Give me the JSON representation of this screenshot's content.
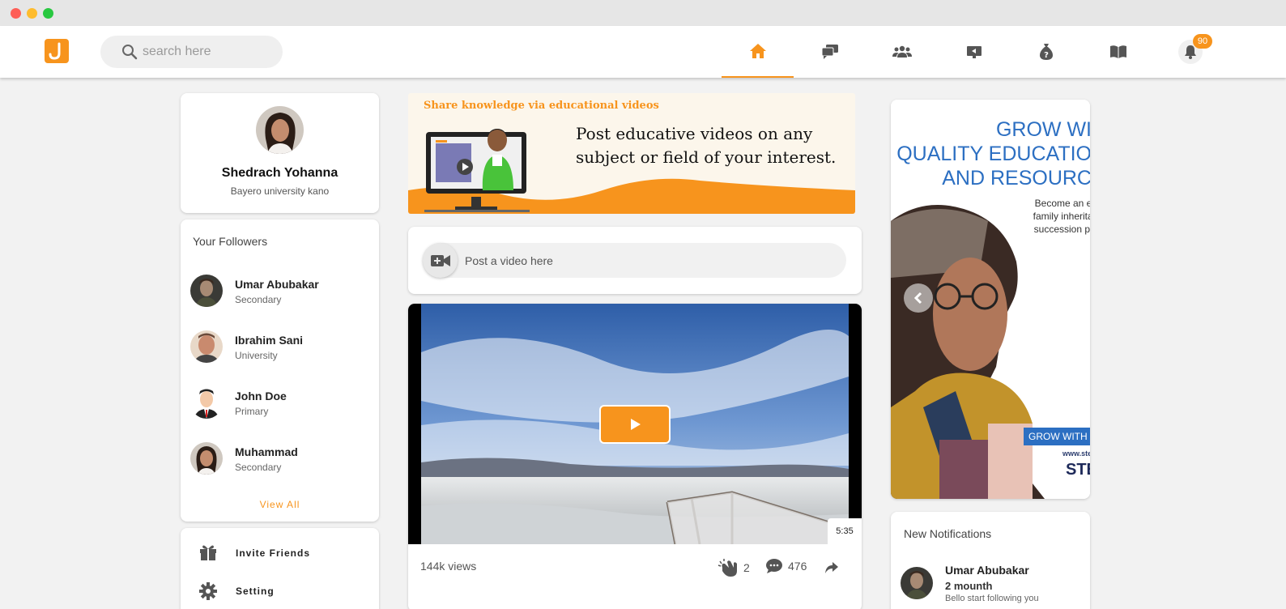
{
  "window": {
    "controls": [
      "close",
      "minimize",
      "maximize"
    ]
  },
  "header": {
    "logo_letter": "J",
    "search_placeholder": "search here",
    "nav": [
      {
        "name": "home-icon",
        "active": true
      },
      {
        "name": "chat-icon",
        "active": false
      },
      {
        "name": "groups-icon",
        "active": false
      },
      {
        "name": "presentation-icon",
        "active": false
      },
      {
        "name": "question-bag-icon",
        "active": false
      },
      {
        "name": "book-icon",
        "active": false
      },
      {
        "name": "bell-icon",
        "active": false
      }
    ],
    "notification_count": "90"
  },
  "profile": {
    "name": "Shedrach Yohanna",
    "school": "Bayero university kano"
  },
  "followers": {
    "title": "Your Followers",
    "items": [
      {
        "name": "Umar Abubakar",
        "level": "Secondary"
      },
      {
        "name": "Ibrahim Sani",
        "level": "University"
      },
      {
        "name": "John Doe",
        "level": "Primary"
      },
      {
        "name": "Muhammad",
        "level": "Secondary"
      }
    ],
    "view_all": "View All"
  },
  "menu": {
    "invite": "Invite Friends",
    "setting": "Setting"
  },
  "banner": {
    "title": "Share knowledge via educational videos",
    "text": "Post educative videos on any subject or field of your interest."
  },
  "composer": {
    "placeholder": "Post a video here"
  },
  "video": {
    "duration": "5:35",
    "views": "144k views",
    "claps": "2",
    "comments": "476"
  },
  "ad": {
    "headline_1": "GROW WI",
    "headline_2": "QUALITY EDUCATIO",
    "headline_3": "AND RESOURC",
    "sub_1": "Become an ex",
    "sub_2": "family inheritan",
    "sub_3": "succession pla",
    "bar": "GROW WITH",
    "url": "www.step",
    "logo": "STE"
  },
  "notifications": {
    "title": "New Notifications",
    "first": {
      "name": "Umar Abubakar",
      "time": "2 mounth",
      "message": "Bello start following you"
    }
  },
  "colors": {
    "accent": "#f7941d",
    "ad_blue": "#2c6fc2"
  }
}
